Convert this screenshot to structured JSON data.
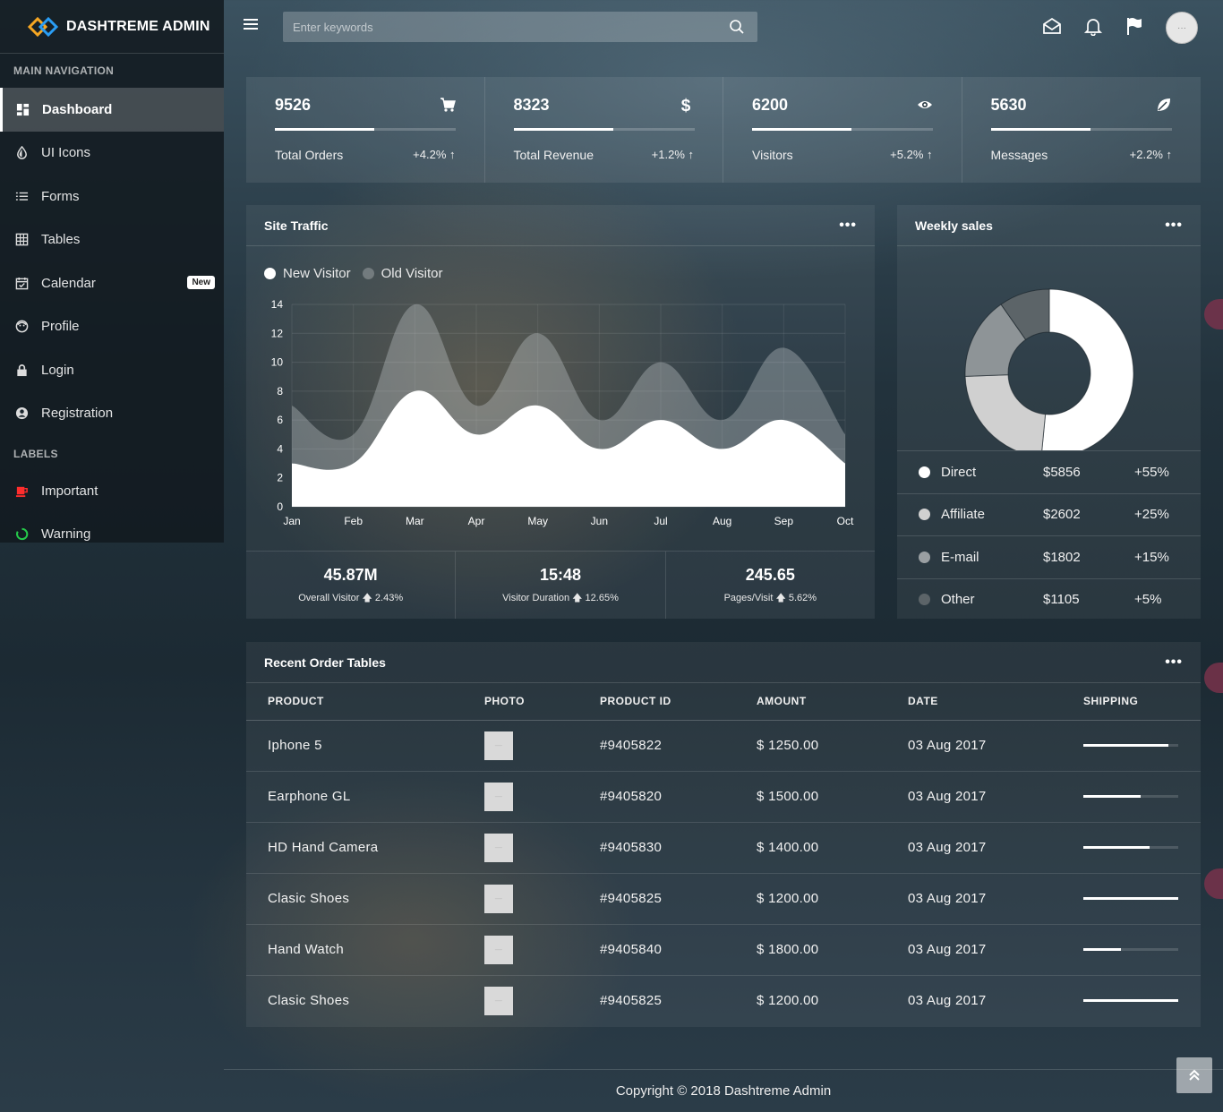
{
  "brand": {
    "name": "DASHTREME ADMIN"
  },
  "sidebar": {
    "header_main": "MAIN NAVIGATION",
    "items": [
      {
        "label": "Dashboard",
        "icon": "dashboard-icon",
        "active": true
      },
      {
        "label": "UI Icons",
        "icon": "tint-icon"
      },
      {
        "label": "Forms",
        "icon": "list-icon"
      },
      {
        "label": "Tables",
        "icon": "grid-icon"
      },
      {
        "label": "Calendar",
        "icon": "calendar-icon",
        "badge": "New"
      },
      {
        "label": "Profile",
        "icon": "face-icon"
      },
      {
        "label": "Login",
        "icon": "lock-icon"
      },
      {
        "label": "Registration",
        "icon": "user-circle-icon"
      }
    ],
    "header_labels": "LABELS",
    "labels": [
      {
        "label": "Important",
        "icon": "coffee-icon",
        "color": "#ff2d2d"
      },
      {
        "label": "Warning",
        "icon": "circle-notch-icon",
        "color": "#25c94a"
      }
    ]
  },
  "topbar": {
    "search_placeholder": "Enter keywords"
  },
  "stats": [
    {
      "value": "9526",
      "label": "Total Orders",
      "change": "+4.2% ↑",
      "progress": 0.55,
      "icon": "cart-icon"
    },
    {
      "value": "8323",
      "label": "Total Revenue",
      "change": "+1.2% ↑",
      "progress": 0.55,
      "icon": "dollar-icon"
    },
    {
      "value": "6200",
      "label": "Visitors",
      "change": "+5.2% ↑",
      "progress": 0.55,
      "icon": "eye-icon"
    },
    {
      "value": "5630",
      "label": "Messages",
      "change": "+2.2% ↑",
      "progress": 0.55,
      "icon": "leaf-icon"
    }
  ],
  "traffic": {
    "title": "Site Traffic",
    "legend_new": "New Visitor",
    "legend_old": "Old Visitor",
    "footer": [
      {
        "value": "45.87M",
        "label": "Overall Visitor",
        "change": "2.43%"
      },
      {
        "value": "15:48",
        "label": "Visitor Duration",
        "change": "12.65%"
      },
      {
        "value": "245.65",
        "label": "Pages/Visit",
        "change": "5.62%"
      }
    ]
  },
  "chart_data": [
    {
      "type": "area",
      "title": "Site Traffic",
      "categories": [
        "Jan",
        "Feb",
        "Mar",
        "Apr",
        "May",
        "Jun",
        "Jul",
        "Aug",
        "Sep",
        "Oct"
      ],
      "series": [
        {
          "name": "New Visitor",
          "values": [
            3,
            3,
            8,
            5,
            7,
            4,
            6,
            4,
            6,
            3
          ]
        },
        {
          "name": "Old Visitor",
          "values": [
            7,
            5,
            14,
            7,
            12,
            6,
            10,
            6,
            11,
            5
          ]
        }
      ],
      "ylim": [
        0,
        14
      ],
      "yticks": [
        0,
        2,
        4,
        6,
        8,
        10,
        12,
        14
      ],
      "grid": true
    },
    {
      "type": "pie",
      "title": "Weekly sales",
      "categories": [
        "Direct",
        "Affiliate",
        "E-mail",
        "Other"
      ],
      "values": [
        5856,
        2602,
        1802,
        1105
      ],
      "percent": [
        "+55%",
        "+25%",
        "+15%",
        "+5%"
      ],
      "colors": [
        "#ffffff",
        "#d0d0d0",
        "#8e9497",
        "#5c6468"
      ]
    }
  ],
  "weekly": {
    "title": "Weekly sales",
    "rows": [
      {
        "name": "Direct",
        "amount": "$5856",
        "pct": "+55%",
        "color": "#ffffff"
      },
      {
        "name": "Affiliate",
        "amount": "$2602",
        "pct": "+25%",
        "color": "#d0d0d0"
      },
      {
        "name": "E-mail",
        "amount": "$1802",
        "pct": "+15%",
        "color": "#9a9fa2"
      },
      {
        "name": "Other",
        "amount": "$1105",
        "pct": "+5%",
        "color": "#5c6468"
      }
    ]
  },
  "orders": {
    "title": "Recent Order Tables",
    "columns": [
      "PRODUCT",
      "PHOTO",
      "PRODUCT ID",
      "AMOUNT",
      "DATE",
      "SHIPPING"
    ],
    "rows": [
      {
        "product": "Iphone 5",
        "id": "#9405822",
        "amount": "$ 1250.00",
        "date": "03 Aug 2017",
        "shipping": 0.9
      },
      {
        "product": "Earphone GL",
        "id": "#9405820",
        "amount": "$ 1500.00",
        "date": "03 Aug 2017",
        "shipping": 0.6
      },
      {
        "product": "HD Hand Camera",
        "id": "#9405830",
        "amount": "$ 1400.00",
        "date": "03 Aug 2017",
        "shipping": 0.7
      },
      {
        "product": "Clasic Shoes",
        "id": "#9405825",
        "amount": "$ 1200.00",
        "date": "03 Aug 2017",
        "shipping": 1.0
      },
      {
        "product": "Hand Watch",
        "id": "#9405840",
        "amount": "$ 1800.00",
        "date": "03 Aug 2017",
        "shipping": 0.4
      },
      {
        "product": "Clasic Shoes",
        "id": "#9405825",
        "amount": "$ 1200.00",
        "date": "03 Aug 2017",
        "shipping": 1.0
      }
    ]
  },
  "footer": {
    "text": "Copyright © 2018 Dashtreme Admin"
  }
}
